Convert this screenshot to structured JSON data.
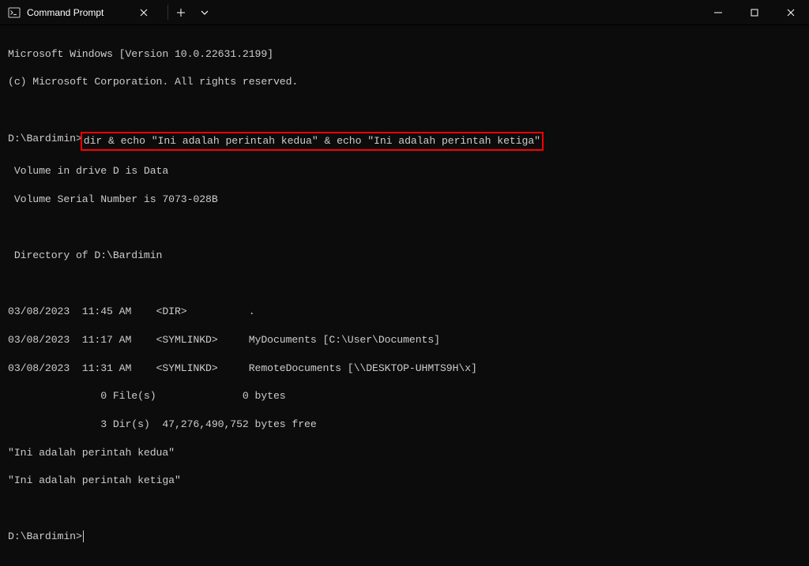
{
  "titlebar": {
    "tab_title": "Command Prompt"
  },
  "terminal": {
    "version_line": "Microsoft Windows [Version 10.0.22631.2199]",
    "copyright_line": "(c) Microsoft Corporation. All rights reserved.",
    "prompt1_path": "D:\\Bardimin>",
    "prompt1_command": "dir & echo \"Ini adalah perintah kedua\" & echo \"Ini adalah perintah ketiga\"",
    "out_volume": " Volume in drive D is Data",
    "out_serial": " Volume Serial Number is 7073-028B",
    "out_dirof": " Directory of D:\\Bardimin",
    "out_row1": "03/08/2023  11:45 AM    <DIR>          .",
    "out_row2": "03/08/2023  11:17 AM    <SYMLINKD>     MyDocuments [C:\\User\\Documents]",
    "out_row3": "03/08/2023  11:31 AM    <SYMLINKD>     RemoteDocuments [\\\\DESKTOP-UHMTS9H\\x]",
    "out_files": "               0 File(s)              0 bytes",
    "out_dirs": "               3 Dir(s)  47,276,490,752 bytes free",
    "out_echo1": "\"Ini adalah perintah kedua\"",
    "out_echo2": "\"Ini adalah perintah ketiga\"",
    "prompt2_path": "D:\\Bardimin>"
  }
}
